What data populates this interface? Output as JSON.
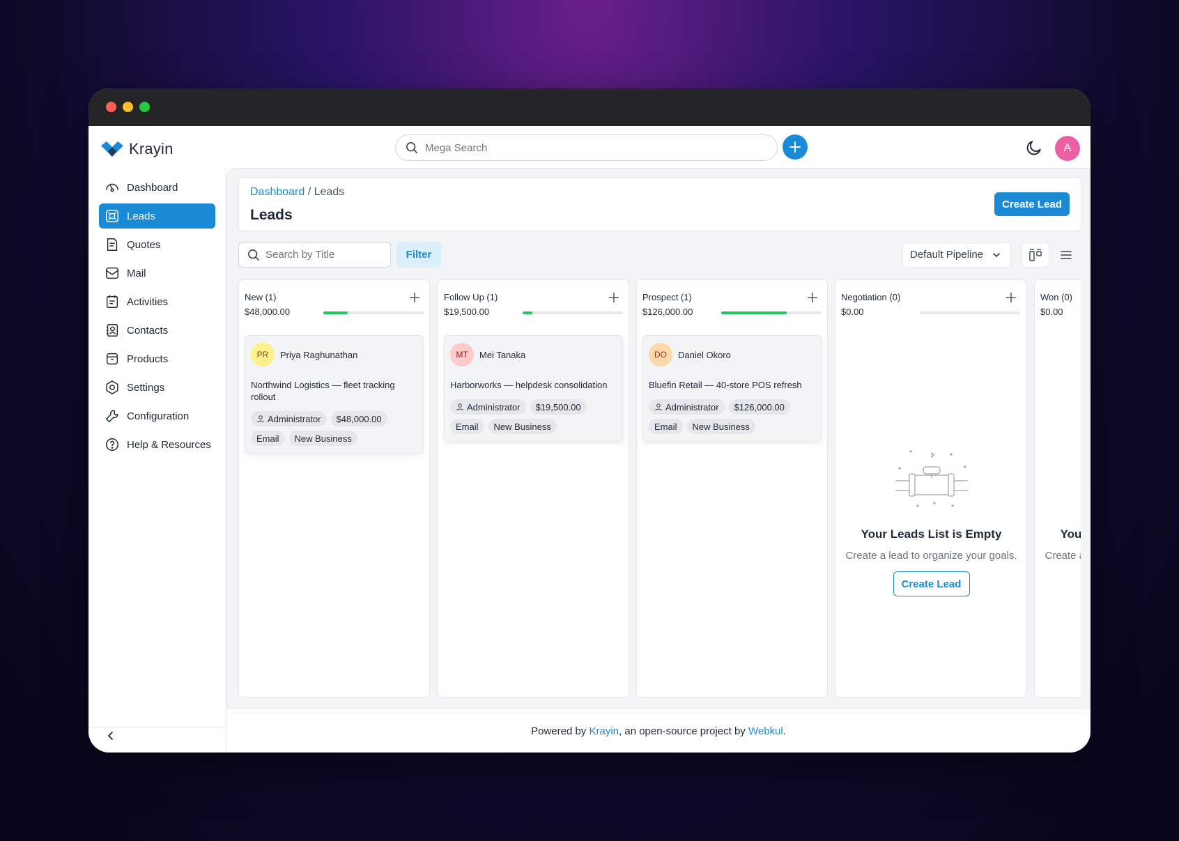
{
  "app": {
    "name": "Krayin"
  },
  "topbar": {
    "search_placeholder": "Mega Search",
    "avatar_initial": "A"
  },
  "sidebar": {
    "items": [
      {
        "label": "Dashboard",
        "icon": "dashboard-icon",
        "active": false
      },
      {
        "label": "Leads",
        "icon": "leads-icon",
        "active": true
      },
      {
        "label": "Quotes",
        "icon": "quotes-icon",
        "active": false
      },
      {
        "label": "Mail",
        "icon": "mail-icon",
        "active": false
      },
      {
        "label": "Activities",
        "icon": "activities-icon",
        "active": false
      },
      {
        "label": "Contacts",
        "icon": "contacts-icon",
        "active": false
      },
      {
        "label": "Products",
        "icon": "products-icon",
        "active": false
      },
      {
        "label": "Settings",
        "icon": "settings-icon",
        "active": false
      },
      {
        "label": "Configuration",
        "icon": "configuration-icon",
        "active": false
      },
      {
        "label": "Help & Resources",
        "icon": "help-icon",
        "active": false
      }
    ]
  },
  "header": {
    "breadcrumb_root": "Dashboard",
    "breadcrumb_sep": " / ",
    "breadcrumb_current": "Leads",
    "title": "Leads",
    "create_label": "Create Lead"
  },
  "toolbar": {
    "search_placeholder": "Search by Title",
    "filter_label": "Filter",
    "pipeline": "Default Pipeline"
  },
  "columns": [
    {
      "title": "New (1)",
      "amount": "$48,000.00",
      "progress": 0.24,
      "card": {
        "initials": "PR",
        "name": "Priya Raghunathan",
        "title": "Northwind Logistics — fleet tracking rollout",
        "owner": "Administrator",
        "value": "$48,000.00",
        "source": "Email",
        "type": "New Business"
      }
    },
    {
      "title": "Follow Up (1)",
      "amount": "$19,500.00",
      "progress": 0.1,
      "card": {
        "initials": "MT",
        "name": "Mei Tanaka",
        "title": "Harborworks — helpdesk consolidation",
        "owner": "Administrator",
        "value": "$19,500.00",
        "source": "Email",
        "type": "New Business"
      }
    },
    {
      "title": "Prospect (1)",
      "amount": "$126,000.00",
      "progress": 0.65,
      "card": {
        "initials": "DO",
        "name": "Daniel Okoro",
        "title": "Bluefin Retail — 40-store POS refresh",
        "owner": "Administrator",
        "value": "$126,000.00",
        "source": "Email",
        "type": "New Business"
      }
    },
    {
      "title": "Negotiation (0)",
      "amount": "$0.00",
      "progress": 0
    },
    {
      "title": "Won (0)",
      "amount": "$0.00",
      "progress": 0
    }
  ],
  "empty": {
    "title": "Your Leads List is Empty",
    "subtitle": "Create a lead to organize your goals.",
    "button": "Create Lead"
  },
  "footer": {
    "prefix": "Powered by ",
    "link1": "Krayin",
    "middle": ", an open-source project by ",
    "link2": "Webkul",
    "suffix": "."
  },
  "colors": {
    "primary": "#1a8ad6",
    "progress": "#22c55e",
    "avatar": "#ec5fa3"
  }
}
